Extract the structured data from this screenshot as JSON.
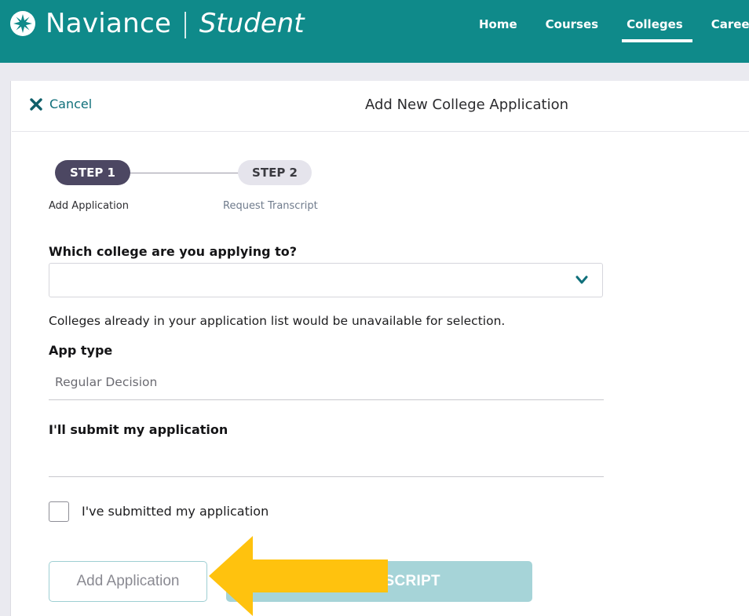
{
  "header": {
    "brand_name": "Naviance",
    "brand_separator": "|",
    "brand_sub": "Student",
    "nav": [
      {
        "label": "Home",
        "active": false
      },
      {
        "label": "Courses",
        "active": false
      },
      {
        "label": "Colleges",
        "active": true
      },
      {
        "label": "Careers",
        "active": false
      }
    ],
    "color": "#0f8a8a"
  },
  "titlebar": {
    "cancel_label": "Cancel",
    "title": "Add New College Application"
  },
  "stepper": {
    "steps": [
      {
        "pill": "STEP 1",
        "label": "Add Application",
        "active": true
      },
      {
        "pill": "STEP 2",
        "label": "Request Transcript",
        "active": false
      }
    ]
  },
  "form": {
    "college_question": "Which college are you applying to?",
    "college_value": "",
    "college_help": "Colleges already in your application list would be unavailable for selection.",
    "app_type_label": "App type",
    "app_type_value": "Regular Decision",
    "submit_label": "I'll submit my application",
    "submitted_checkbox_label": "I've submitted my application",
    "submitted_checked": false
  },
  "buttons": {
    "add_application": "Add Application",
    "request_transcript": "ST TRANSCRIPT"
  },
  "annotation": {
    "arrow_color": "#ffc20e",
    "arrow_icon": "arrow-left-icon"
  }
}
